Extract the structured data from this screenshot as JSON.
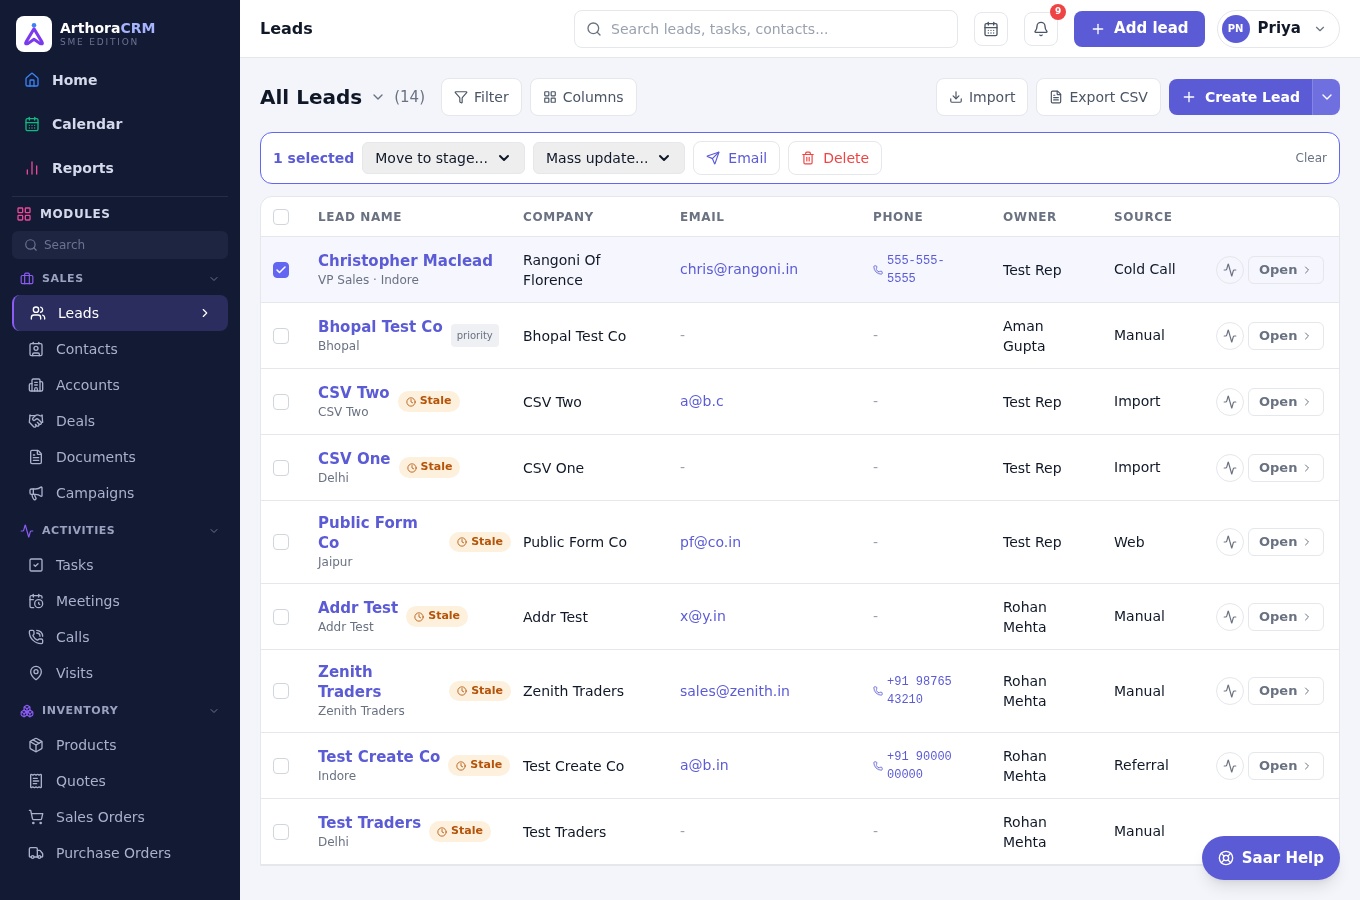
{
  "brand": {
    "name": "Arthora",
    "name_accent": "CRM",
    "edition": "SME EDITION"
  },
  "nav_top": [
    {
      "label": "Home",
      "selected": false
    },
    {
      "label": "Calendar",
      "selected": false
    },
    {
      "label": "Reports",
      "selected": false
    }
  ],
  "modules": {
    "title": "MODULES",
    "search_placeholder": "Search"
  },
  "groups": [
    {
      "title": "SALES",
      "expanded": true,
      "items": [
        {
          "label": "Leads",
          "selected": true
        },
        {
          "label": "Contacts",
          "selected": false
        },
        {
          "label": "Accounts",
          "selected": false
        },
        {
          "label": "Deals",
          "selected": false
        },
        {
          "label": "Documents",
          "selected": false
        },
        {
          "label": "Campaigns",
          "selected": false
        }
      ]
    },
    {
      "title": "ACTIVITIES",
      "expanded": true,
      "items": [
        {
          "label": "Tasks",
          "selected": false
        },
        {
          "label": "Meetings",
          "selected": false
        },
        {
          "label": "Calls",
          "selected": false
        },
        {
          "label": "Visits",
          "selected": false
        }
      ]
    },
    {
      "title": "INVENTORY",
      "expanded": true,
      "items": [
        {
          "label": "Products",
          "selected": false
        },
        {
          "label": "Quotes",
          "selected": false
        },
        {
          "label": "Sales Orders",
          "selected": false
        },
        {
          "label": "Purchase Orders",
          "selected": false
        }
      ]
    }
  ],
  "header": {
    "title": "Leads",
    "search_placeholder": "Search leads, tasks, contacts...",
    "notifications": "9",
    "add_button": "Add lead",
    "user": {
      "initials": "PN",
      "name": "Priya"
    }
  },
  "toolbar": {
    "view": "All Leads",
    "count": "(14)",
    "filter": "Filter",
    "columns": "Columns",
    "import": "Import",
    "export": "Export CSV",
    "create": "Create Lead"
  },
  "bulk": {
    "selected": "1 selected",
    "stage_select": "Move to stage...",
    "mass_select": "Mass update...",
    "email": "Email",
    "delete": "Delete",
    "clear": "Clear"
  },
  "table": {
    "columns": [
      "LEAD NAME",
      "COMPANY",
      "EMAIL",
      "PHONE",
      "OWNER",
      "SOURCE"
    ],
    "all_checked": false,
    "rows": [
      {
        "selected": true,
        "name": "Christopher Maclead",
        "sub": "VP Sales · Indore",
        "company": "Rangoni Of Florence",
        "email": "chris@rangoni.in",
        "phone": "555-555-5555",
        "owner": "Test Rep",
        "source": "Cold Call",
        "action": "Open"
      },
      {
        "selected": false,
        "name": "Bhopal Test Co",
        "sub": "Bhopal",
        "badge": {
          "kind": "priority",
          "label": "priority"
        },
        "company": "Bhopal Test Co",
        "email": "-",
        "phone": "-",
        "owner": "Aman Gupta",
        "source": "Manual",
        "action": "Open"
      },
      {
        "selected": false,
        "name": "CSV Two",
        "sub": "CSV Two",
        "badge": {
          "kind": "stale",
          "label": "Stale"
        },
        "company": "CSV Two",
        "email": "a@b.c",
        "phone": "-",
        "owner": "Test Rep",
        "source": "Import",
        "action": "Open"
      },
      {
        "selected": false,
        "name": "CSV One",
        "sub": "Delhi",
        "badge": {
          "kind": "stale",
          "label": "Stale"
        },
        "company": "CSV One",
        "email": "-",
        "phone": "-",
        "owner": "Test Rep",
        "source": "Import",
        "action": "Open"
      },
      {
        "selected": false,
        "name": "Public Form Co",
        "sub": "Jaipur",
        "badge": {
          "kind": "stale",
          "label": "Stale"
        },
        "company": "Public Form Co",
        "email": "pf@co.in",
        "phone": "-",
        "owner": "Test Rep",
        "source": "Web",
        "action": "Open"
      },
      {
        "selected": false,
        "name": "Addr Test",
        "sub": "Addr Test",
        "badge": {
          "kind": "stale",
          "label": "Stale"
        },
        "company": "Addr Test",
        "email": "x@y.in",
        "phone": "-",
        "owner": "Rohan Mehta",
        "source": "Manual",
        "action": "Open"
      },
      {
        "selected": false,
        "name": "Zenith Traders",
        "sub": "Zenith Traders",
        "badge": {
          "kind": "stale",
          "label": "Stale"
        },
        "company": "Zenith Traders",
        "email": "sales@zenith.in",
        "phone": "+91 98765 43210",
        "owner": "Rohan Mehta",
        "source": "Manual",
        "action": "Open"
      },
      {
        "selected": false,
        "name": "Test Create Co",
        "sub": "Indore",
        "badge": {
          "kind": "stale",
          "label": "Stale"
        },
        "company": "Test Create Co",
        "email": "a@b.in",
        "phone": "+91 90000 00000",
        "owner": "Rohan Mehta",
        "source": "Referral",
        "action": "Open"
      },
      {
        "selected": false,
        "name": "Test Traders",
        "sub": "Delhi",
        "badge": {
          "kind": "stale",
          "label": "Stale"
        },
        "company": "Test Traders",
        "email": "-",
        "phone": "-",
        "owner": "Rohan Mehta",
        "source": "Manual"
      }
    ]
  },
  "help_button": "Saar Help"
}
